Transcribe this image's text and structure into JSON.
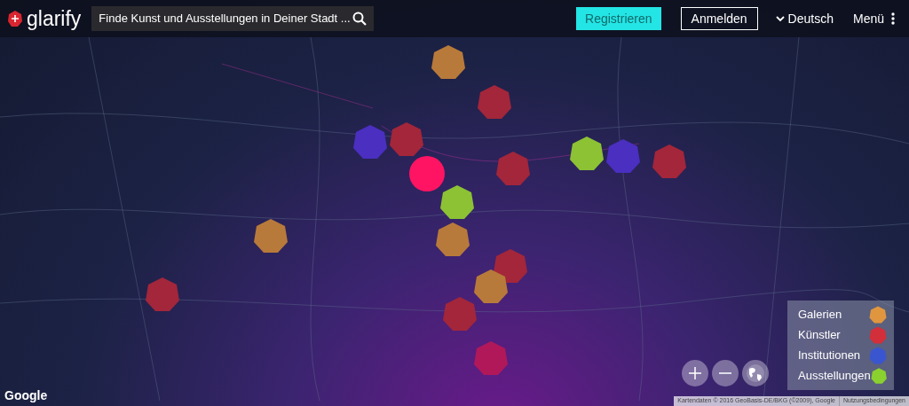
{
  "header": {
    "logo": "glarify",
    "search": {
      "placeholder": "Finde Kunst und Ausstellungen in Deiner Stadt ..."
    },
    "register_button": "Registrieren",
    "login_button": "Anmelden",
    "language": "Deutsch",
    "menu": "Menü"
  },
  "map": {
    "markers": [
      {
        "kind": "hex",
        "color": "#b87a3a"
      },
      {
        "kind": "hex",
        "color": "#a3263a"
      },
      {
        "kind": "hex",
        "color": "#4a2fc0"
      },
      {
        "kind": "hex",
        "color": "#a3263a"
      },
      {
        "kind": "circle",
        "color": "#ff1463"
      },
      {
        "kind": "hex",
        "color": "#a3263a"
      },
      {
        "kind": "hex",
        "color": "#4a2fc0"
      },
      {
        "kind": "hex",
        "color": "#8cc234"
      },
      {
        "kind": "hex",
        "color": "#a3263a"
      },
      {
        "kind": "hex",
        "color": "#8cc234"
      },
      {
        "kind": "hex",
        "color": "#b87a3a"
      },
      {
        "kind": "hex",
        "color": "#b87a3a"
      },
      {
        "kind": "hex",
        "color": "#a3263a"
      },
      {
        "kind": "hex",
        "color": "#b87a3a"
      },
      {
        "kind": "hex",
        "color": "#a3263a"
      },
      {
        "kind": "hex",
        "color": "#a3263a"
      },
      {
        "kind": "hex",
        "color": "#b0185a"
      }
    ],
    "legend": [
      {
        "label": "Galerien",
        "color": "#e0963f"
      },
      {
        "label": "Künstler",
        "color": "#d22f3a"
      },
      {
        "label": "Institutionen",
        "color": "#3a55d0"
      },
      {
        "label": "Ausstellungen",
        "color": "#8ad02f"
      }
    ],
    "google_logo": "Google",
    "attribution": "Kartendaten © 2016 GeoBasis-DE/BKG (©2009), Google",
    "terms_link": "Nutzungsbedingungen"
  }
}
